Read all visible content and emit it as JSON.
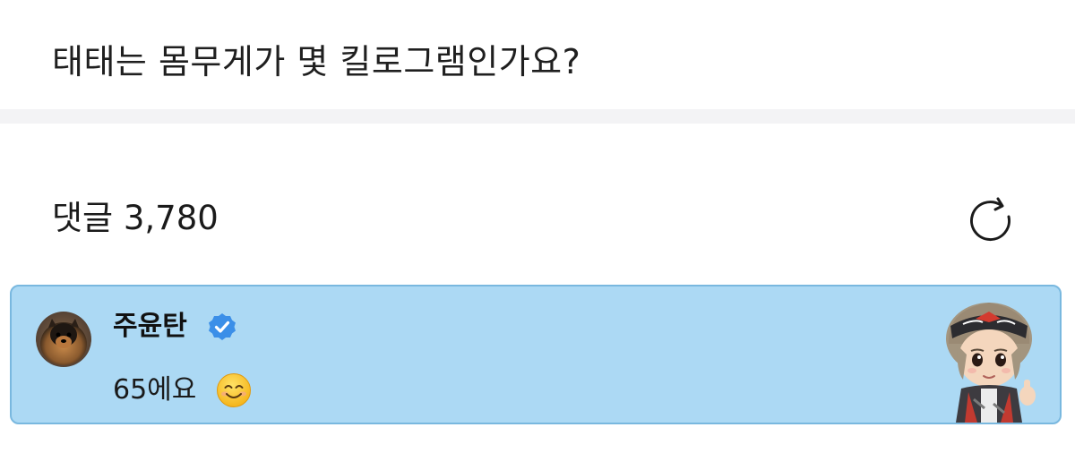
{
  "question": {
    "text": "태태는 몸무게가 몇 킬로그램인가요?"
  },
  "comments": {
    "label": "댓글",
    "count": "3,780",
    "refresh_icon": "refresh-icon"
  },
  "comment": {
    "author": "주윤탄",
    "verified_icon": "verified-badge-icon",
    "text": "65에요",
    "emoji_icon": "smiling-face-emoji",
    "avatar_icon": "dog-avatar",
    "sticker_icon": "character-sticker"
  },
  "colors": {
    "highlight_bg": "#acd9f4",
    "highlight_border": "#79b8df",
    "verified": "#3b8fe8",
    "divider": "#f3f3f5"
  }
}
